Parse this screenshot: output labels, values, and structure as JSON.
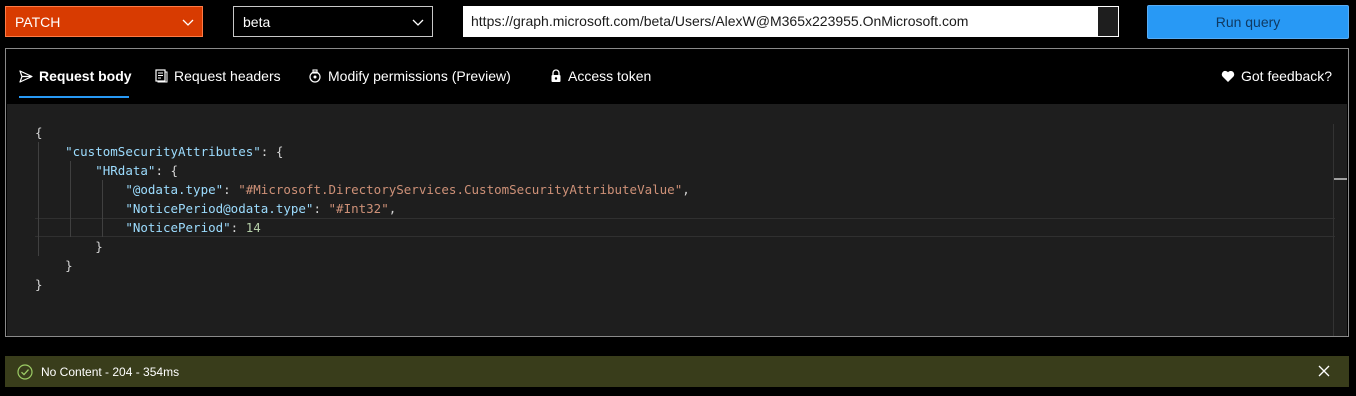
{
  "toolbar": {
    "method": "PATCH",
    "version": "beta",
    "url": "https://graph.microsoft.com/beta/Users/AlexW@M365x223955.OnMicrosoft.com",
    "run_label": "Run query"
  },
  "tabs": [
    {
      "label": "Request body",
      "icon": "send-icon",
      "active": true
    },
    {
      "label": "Request headers",
      "icon": "document-icon",
      "active": false
    },
    {
      "label": "Modify permissions (Preview)",
      "icon": "permissions-icon",
      "active": false
    },
    {
      "label": "Access token",
      "icon": "token-icon",
      "active": false
    }
  ],
  "feedback_label": "Got feedback?",
  "request_body": {
    "line1": "{",
    "attr_key": "\"customSecurityAttributes\"",
    "hr_key": "\"HRdata\"",
    "odata_type_key": "\"@odata.type\"",
    "odata_type_value": "\"#Microsoft.DirectoryServices.CustomSecurityAttributeValue\"",
    "notice_type_key": "\"NoticePeriod@odata.type\"",
    "notice_type_value": "\"#Int32\"",
    "notice_key": "\"NoticePeriod\"",
    "notice_value": "14",
    "close_inner": "}",
    "close_mid": "}",
    "close_outer": "}"
  },
  "status": {
    "message": "No Content - 204 - 354ms",
    "color": "#393d1b"
  },
  "colors": {
    "method": "#d83b01",
    "run_button": "#2899f5",
    "json_key": "#9cdcfe",
    "json_string": "#ce9178",
    "json_number": "#b5cea8"
  }
}
